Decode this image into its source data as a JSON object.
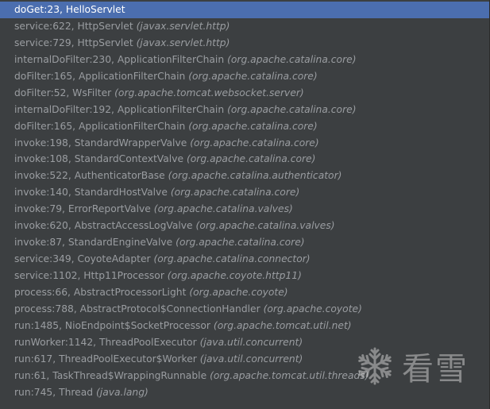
{
  "frames": [
    {
      "method": "doGet:23, HelloServlet",
      "pkg": ""
    },
    {
      "method": "service:622, HttpServlet",
      "pkg": "(javax.servlet.http)"
    },
    {
      "method": "service:729, HttpServlet",
      "pkg": "(javax.servlet.http)"
    },
    {
      "method": "internalDoFilter:230, ApplicationFilterChain",
      "pkg": "(org.apache.catalina.core)"
    },
    {
      "method": "doFilter:165, ApplicationFilterChain",
      "pkg": "(org.apache.catalina.core)"
    },
    {
      "method": "doFilter:52, WsFilter",
      "pkg": "(org.apache.tomcat.websocket.server)"
    },
    {
      "method": "internalDoFilter:192, ApplicationFilterChain",
      "pkg": "(org.apache.catalina.core)"
    },
    {
      "method": "doFilter:165, ApplicationFilterChain",
      "pkg": "(org.apache.catalina.core)"
    },
    {
      "method": "invoke:198, StandardWrapperValve",
      "pkg": "(org.apache.catalina.core)"
    },
    {
      "method": "invoke:108, StandardContextValve",
      "pkg": "(org.apache.catalina.core)"
    },
    {
      "method": "invoke:522, AuthenticatorBase",
      "pkg": "(org.apache.catalina.authenticator)"
    },
    {
      "method": "invoke:140, StandardHostValve",
      "pkg": "(org.apache.catalina.core)"
    },
    {
      "method": "invoke:79, ErrorReportValve",
      "pkg": "(org.apache.catalina.valves)"
    },
    {
      "method": "invoke:620, AbstractAccessLogValve",
      "pkg": "(org.apache.catalina.valves)"
    },
    {
      "method": "invoke:87, StandardEngineValve",
      "pkg": "(org.apache.catalina.core)"
    },
    {
      "method": "service:349, CoyoteAdapter",
      "pkg": "(org.apache.catalina.connector)"
    },
    {
      "method": "service:1102, Http11Processor",
      "pkg": "(org.apache.coyote.http11)"
    },
    {
      "method": "process:66, AbstractProcessorLight",
      "pkg": "(org.apache.coyote)"
    },
    {
      "method": "process:788, AbstractProtocol$ConnectionHandler",
      "pkg": "(org.apache.coyote)"
    },
    {
      "method": "run:1485, NioEndpoint$SocketProcessor",
      "pkg": "(org.apache.tomcat.util.net)"
    },
    {
      "method": "runWorker:1142, ThreadPoolExecutor",
      "pkg": "(java.util.concurrent)"
    },
    {
      "method": "run:617, ThreadPoolExecutor$Worker",
      "pkg": "(java.util.concurrent)"
    },
    {
      "method": "run:61, TaskThread$WrappingRunnable",
      "pkg": "(org.apache.tomcat.util.threads)"
    },
    {
      "method": "run:745, Thread",
      "pkg": "(java.lang)"
    }
  ],
  "selected_index": 0,
  "watermark": {
    "icon": "snowflake-icon",
    "text": "看雪"
  },
  "colors": {
    "background": "#3c3f41",
    "selection": "#4b6eaf",
    "text": "#9a9da1",
    "selected_text": "#ffffff"
  }
}
